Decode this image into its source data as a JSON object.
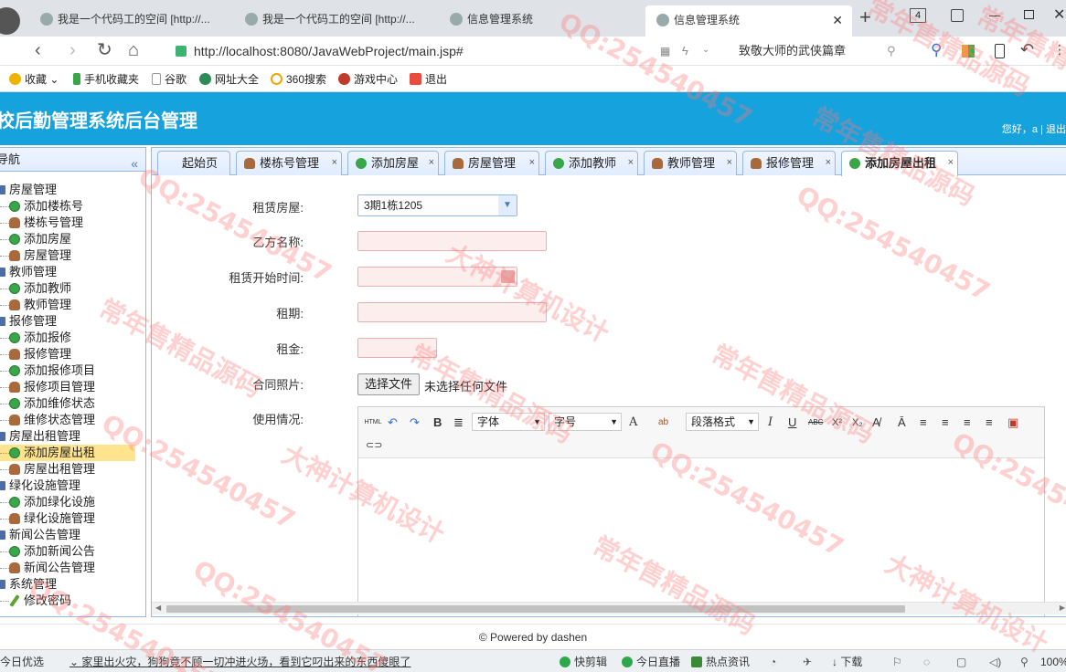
{
  "browser": {
    "tabs": [
      {
        "label": "我是一个代码工的空间 [http://..."
      },
      {
        "label": "我是一个代码工的空间 [http://..."
      },
      {
        "label": "信息管理系统"
      },
      {
        "label": "信息管理系统",
        "active": true
      }
    ],
    "tab_count": "4",
    "new_tab": "+",
    "url": "http://localhost:8080/JavaWebProject/main.jsp#",
    "search_text": "致敬大师的武侠篇章",
    "bookmarks": [
      "收藏",
      "手机收藏夹",
      "谷歌",
      "网址大全",
      "360搜索",
      "游戏中心",
      "退出"
    ]
  },
  "app": {
    "title": "校后勤管理系统后台管理",
    "welcome": "您好，a | 退出"
  },
  "sidebar": {
    "header": "导航",
    "collapse_icon": "«",
    "tree": [
      {
        "label": "房屋管理",
        "type": "group"
      },
      {
        "label": "添加楼栋号",
        "type": "add"
      },
      {
        "label": "楼栋号管理",
        "type": "mgr"
      },
      {
        "label": "添加房屋",
        "type": "add"
      },
      {
        "label": "房屋管理",
        "type": "mgr"
      },
      {
        "label": "教师管理",
        "type": "group"
      },
      {
        "label": "添加教师",
        "type": "add"
      },
      {
        "label": "教师管理",
        "type": "mgr"
      },
      {
        "label": "报修管理",
        "type": "group"
      },
      {
        "label": "添加报修",
        "type": "add"
      },
      {
        "label": "报修管理",
        "type": "mgr"
      },
      {
        "label": "添加报修项目",
        "type": "add"
      },
      {
        "label": "报修项目管理",
        "type": "mgr"
      },
      {
        "label": "添加维修状态",
        "type": "add"
      },
      {
        "label": "维修状态管理",
        "type": "mgr"
      },
      {
        "label": "房屋出租管理",
        "type": "group"
      },
      {
        "label": "添加房屋出租",
        "type": "add",
        "selected": true
      },
      {
        "label": "房屋出租管理",
        "type": "mgr"
      },
      {
        "label": "绿化设施管理",
        "type": "group"
      },
      {
        "label": "添加绿化设施",
        "type": "add"
      },
      {
        "label": "绿化设施管理",
        "type": "mgr"
      },
      {
        "label": "新闻公告管理",
        "type": "group"
      },
      {
        "label": "添加新闻公告",
        "type": "add"
      },
      {
        "label": "新闻公告管理",
        "type": "mgr"
      },
      {
        "label": "系统管理",
        "type": "group"
      },
      {
        "label": "修改密码",
        "type": "pen"
      }
    ]
  },
  "panel_tabs": [
    {
      "label": "起始页",
      "icon": "none"
    },
    {
      "label": "楼栋号管理",
      "icon": "mgr"
    },
    {
      "label": "添加房屋",
      "icon": "add"
    },
    {
      "label": "房屋管理",
      "icon": "mgr"
    },
    {
      "label": "添加教师",
      "icon": "add"
    },
    {
      "label": "教师管理",
      "icon": "mgr"
    },
    {
      "label": "报修管理",
      "icon": "mgr"
    },
    {
      "label": "添加房屋出租",
      "icon": "add",
      "active": true
    }
  ],
  "form": {
    "house_label": "租赁房屋:",
    "house_value": "3期1栋1205",
    "party_b_label": "乙方名称:",
    "start_label": "租赁开始时间:",
    "term_label": "租期:",
    "rent_label": "租金:",
    "photo_label": "合同照片:",
    "file_button": "选择文件",
    "file_status": "未选择任何文件",
    "usage_label": "使用情况:"
  },
  "editor": {
    "font_select": "字体",
    "size_select": "字号",
    "format_select": "段落格式",
    "buttons": [
      "HTML",
      "↶",
      "↷",
      "B",
      "≣",
      "A",
      "ab",
      "I",
      "U",
      "ABC",
      "X²",
      "X₂",
      "A̸",
      "Ā",
      "≡",
      "≡",
      "≡",
      "≡",
      "▣"
    ]
  },
  "footer": "© Powered by dashen",
  "statusbar": {
    "left": "今日优选",
    "news": "家里出火灾，狗狗竟不顾一切冲进火场，看到它叼出来的东西傻眼了",
    "items": [
      "快剪辑",
      "今日直播",
      "热点资讯",
      "下载"
    ],
    "zoom": "100%"
  },
  "watermark": [
    "QQ:254540457",
    "常年售精品源码",
    "大神计算机设计"
  ]
}
